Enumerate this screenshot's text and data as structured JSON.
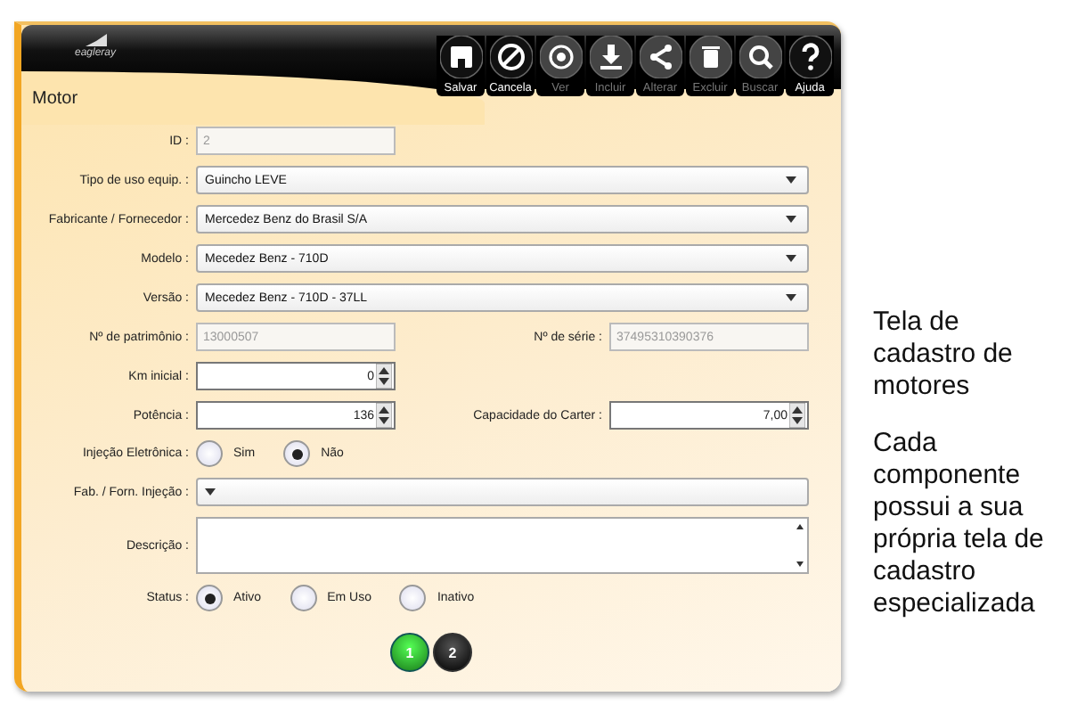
{
  "logo": {
    "text": "eagleray"
  },
  "toolbar": [
    {
      "label": "Salvar",
      "disabled": false
    },
    {
      "label": "Cancela",
      "disabled": false
    },
    {
      "label": "Ver",
      "disabled": true
    },
    {
      "label": "Incluir",
      "disabled": true
    },
    {
      "label": "Alterar",
      "disabled": true
    },
    {
      "label": "Excluir",
      "disabled": true
    },
    {
      "label": "Buscar",
      "disabled": true
    },
    {
      "label": "Ajuda",
      "disabled": false
    }
  ],
  "title": "Motor",
  "form": [
    {
      "fields": [
        {
          "kind": "text",
          "label": "ID :",
          "value": "2",
          "disabled": true
        }
      ]
    },
    {
      "fields": [
        {
          "kind": "select",
          "label": "Tipo de uso equip. :",
          "value": "Guincho LEVE"
        }
      ]
    },
    {
      "fields": [
        {
          "kind": "select",
          "label": "Fabricante / Fornecedor :",
          "value": "Mercedez Benz do Brasil S/A"
        }
      ]
    },
    {
      "fields": [
        {
          "kind": "select",
          "label": "Modelo :",
          "value": "Mecedez Benz - 710D"
        }
      ]
    },
    {
      "fields": [
        {
          "kind": "select",
          "label": "Versão :",
          "value": "Mecedez Benz - 710D - 37LL"
        }
      ]
    },
    {
      "fields": [
        {
          "kind": "text",
          "label": "Nº de patrimônio :",
          "value": "13000507",
          "disabled": true
        },
        {
          "kind": "text",
          "label": "Nº de série :",
          "value": "37495310390376",
          "disabled": true
        }
      ]
    },
    {
      "fields": [
        {
          "kind": "spinner",
          "label": "Km inicial :",
          "value": "0"
        }
      ]
    },
    {
      "fields": [
        {
          "kind": "spinner",
          "label": "Potência :",
          "value": "136"
        },
        {
          "kind": "spinner",
          "label": "Capacidade do Carter :",
          "value": "7,00"
        }
      ]
    },
    {
      "fields": [
        {
          "kind": "radio",
          "label": "Injeção Eletrônica :",
          "options": [
            {
              "label": "Sim",
              "selected": false
            },
            {
              "label": "Não",
              "selected": true
            }
          ]
        }
      ]
    },
    {
      "fields": [
        {
          "kind": "select",
          "label": "Fab. / Forn. Injeção :"
        }
      ]
    },
    {
      "fields": [
        {
          "kind": "textarea",
          "label": "Descrição :"
        }
      ]
    },
    {
      "fields": [
        {
          "kind": "radio",
          "label": "Status :",
          "options": [
            {
              "label": "Ativo",
              "selected": true
            },
            {
              "label": "Em Uso",
              "selected": false
            },
            {
              "label": "Inativo",
              "selected": false
            }
          ]
        }
      ]
    }
  ],
  "pager": [
    {
      "label": "1",
      "selected": true
    },
    {
      "label": "2",
      "selected": false
    }
  ],
  "notes": [
    "Tela de cadastro de motores",
    "Cada componente possui a sua própria tela de cadastro especializada"
  ]
}
